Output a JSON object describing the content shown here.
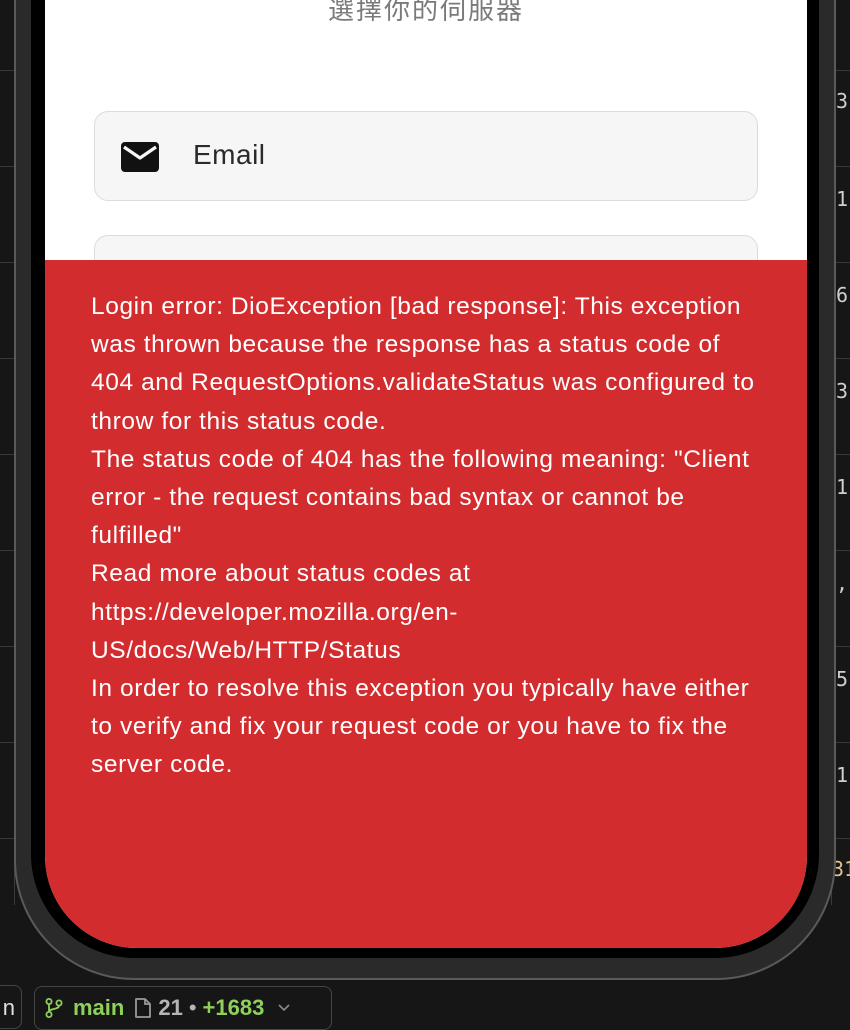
{
  "background_editor": {
    "right_column_values": [
      "3",
      "1",
      "6",
      "3",
      "1",
      ",",
      "5",
      "1",
      "31"
    ]
  },
  "app": {
    "subtitle": "選擇你的伺服器",
    "email_placeholder": "Email",
    "error_message": "Login error: DioException [bad response]: This exception was thrown because the response has a status code of 404 and RequestOptions.validateStatus was configured to throw for this status code.\nThe status code of 404 has the following meaning: \"Client error - the request contains bad syntax or cannot be fulfilled\"\nRead more about status codes at https://developer.mozilla.org/en-US/docs/Web/HTTP/Status\nIn order to resolve this exception you typically have either to verify and fix your request code or you have to fix the server code."
  },
  "statusbar": {
    "left_fragment": "n",
    "branch": "main",
    "changed_files": "21",
    "separator": "•",
    "added_lines": "+1683",
    "icons": [
      "git-branch-icon",
      "file-icon",
      "chevron-down-icon"
    ]
  },
  "colors": {
    "error_background": "#d32c2f",
    "branch_green": "#8fd05a"
  }
}
